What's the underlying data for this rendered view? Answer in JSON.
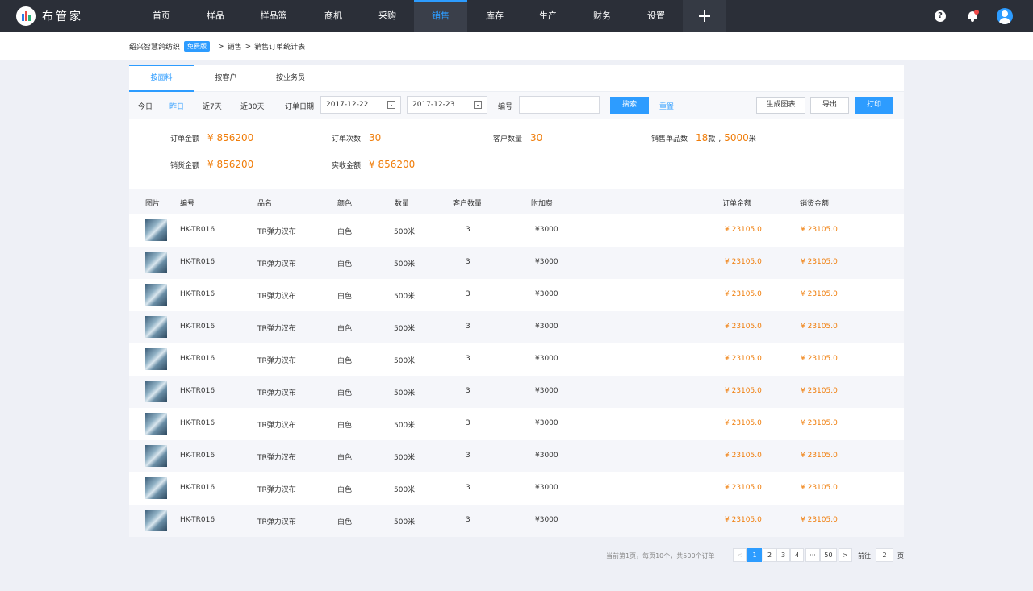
{
  "app": {
    "name": "布管家"
  },
  "nav": [
    {
      "label": "首页",
      "active": false
    },
    {
      "label": "样品",
      "active": false
    },
    {
      "label": "样品篮",
      "active": false
    },
    {
      "label": "商机",
      "active": false
    },
    {
      "label": "采购",
      "active": false
    },
    {
      "label": "销售",
      "active": true
    },
    {
      "label": "库存",
      "active": false
    },
    {
      "label": "生产",
      "active": false
    },
    {
      "label": "财务",
      "active": false
    },
    {
      "label": "设置",
      "active": false
    }
  ],
  "breadcrumb": {
    "company": "绍兴智慧鸽纺织",
    "tag": "免费版",
    "path": [
      "销售",
      "销售订单统计表"
    ]
  },
  "tabs": [
    "按面料",
    "按客户",
    "按业务员"
  ],
  "filters": {
    "quick": [
      "今日",
      "昨日",
      "近7天",
      "近30天"
    ],
    "active_quick": "昨日",
    "order_date_label": "订单日期",
    "date_from": "2017-12-22",
    "date_to": "2017-12-23",
    "code_label": "编号",
    "code_value": "",
    "search_label": "搜索",
    "reset_label": "重置",
    "chart_label": "生成图表",
    "export_label": "导出",
    "print_label": "打印"
  },
  "stats": {
    "order_amount_label": "订单金额",
    "order_amount": "¥ 856200",
    "order_count_label": "订单次数",
    "order_count": "30",
    "customer_count_label": "客户数量",
    "customer_count": "30",
    "sold_items_label": "销售单品数",
    "sold_items_num": "18",
    "sold_items_unit": "款",
    "sold_qty_num": "5000",
    "sold_qty_unit": "米",
    "sales_amount_label": "销货金额",
    "sales_amount": "¥ 856200",
    "received_label": "实收金额",
    "received_amount": "¥ 856200"
  },
  "table": {
    "columns": [
      "图片",
      "编号",
      "品名",
      "颜色",
      "数量",
      "客户数量",
      "附加费",
      "订单金额",
      "销货金额"
    ],
    "rows": [
      {
        "code": "HK-TR016",
        "name": "TR弹力汉布",
        "color": "白色",
        "qty": "500米",
        "customers": "3",
        "surcharge": "¥3000",
        "order_amount": "¥ 23105.0",
        "sales_amount": "¥ 23105.0"
      },
      {
        "code": "HK-TR016",
        "name": "TR弹力汉布",
        "color": "白色",
        "qty": "500米",
        "customers": "3",
        "surcharge": "¥3000",
        "order_amount": "¥ 23105.0",
        "sales_amount": "¥ 23105.0"
      },
      {
        "code": "HK-TR016",
        "name": "TR弹力汉布",
        "color": "白色",
        "qty": "500米",
        "customers": "3",
        "surcharge": "¥3000",
        "order_amount": "¥ 23105.0",
        "sales_amount": "¥ 23105.0"
      },
      {
        "code": "HK-TR016",
        "name": "TR弹力汉布",
        "color": "白色",
        "qty": "500米",
        "customers": "3",
        "surcharge": "¥3000",
        "order_amount": "¥ 23105.0",
        "sales_amount": "¥ 23105.0"
      },
      {
        "code": "HK-TR016",
        "name": "TR弹力汉布",
        "color": "白色",
        "qty": "500米",
        "customers": "3",
        "surcharge": "¥3000",
        "order_amount": "¥ 23105.0",
        "sales_amount": "¥ 23105.0"
      },
      {
        "code": "HK-TR016",
        "name": "TR弹力汉布",
        "color": "白色",
        "qty": "500米",
        "customers": "3",
        "surcharge": "¥3000",
        "order_amount": "¥ 23105.0",
        "sales_amount": "¥ 23105.0"
      },
      {
        "code": "HK-TR016",
        "name": "TR弹力汉布",
        "color": "白色",
        "qty": "500米",
        "customers": "3",
        "surcharge": "¥3000",
        "order_amount": "¥ 23105.0",
        "sales_amount": "¥ 23105.0"
      },
      {
        "code": "HK-TR016",
        "name": "TR弹力汉布",
        "color": "白色",
        "qty": "500米",
        "customers": "3",
        "surcharge": "¥3000",
        "order_amount": "¥ 23105.0",
        "sales_amount": "¥ 23105.0"
      },
      {
        "code": "HK-TR016",
        "name": "TR弹力汉布",
        "color": "白色",
        "qty": "500米",
        "customers": "3",
        "surcharge": "¥3000",
        "order_amount": "¥ 23105.0",
        "sales_amount": "¥ 23105.0"
      },
      {
        "code": "HK-TR016",
        "name": "TR弹力汉布",
        "color": "白色",
        "qty": "500米",
        "customers": "3",
        "surcharge": "¥3000",
        "order_amount": "¥ 23105.0",
        "sales_amount": "¥ 23105.0"
      }
    ]
  },
  "pagination": {
    "info": "当前第1页，每页10个，共500个订单",
    "prev": "<",
    "pages": [
      "1",
      "2",
      "3",
      "4",
      "···",
      "50"
    ],
    "current": "1",
    "next": ">",
    "goto_label": "前往",
    "goto_value": "2",
    "page_word": "页"
  },
  "colors": {
    "accent": "#2d9cff",
    "amount": "#f07d0a",
    "topbar": "#2b2f38"
  },
  "icons": [
    "help-icon",
    "bell-icon",
    "user-icon",
    "plus-icon",
    "calendar-icon"
  ]
}
